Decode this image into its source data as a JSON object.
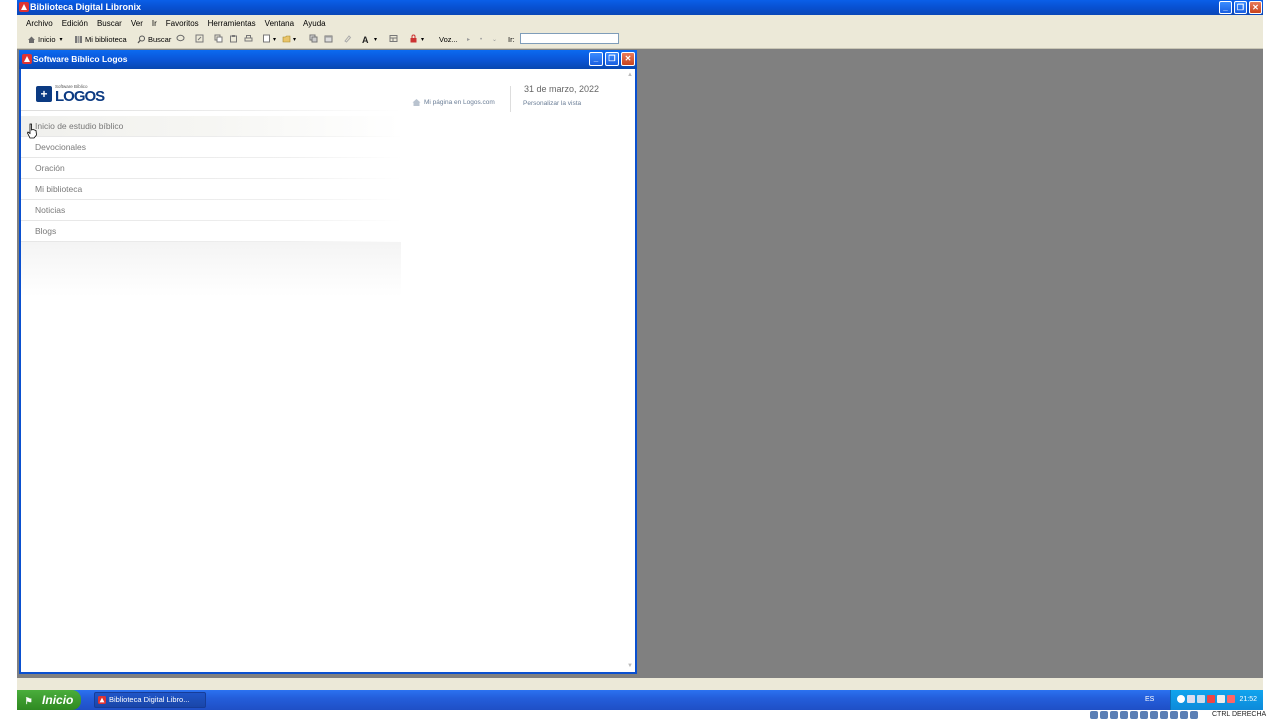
{
  "app": {
    "title": "Biblioteca Digital Libronix",
    "menu": [
      "Archivo",
      "Edición",
      "Buscar",
      "Ver",
      "Ir",
      "Favoritos",
      "Herramientas",
      "Ventana",
      "Ayuda"
    ],
    "toolbar": {
      "home": "Inicio",
      "library": "Mi biblioteca",
      "search": "Buscar",
      "voice": "Voz...",
      "goto_label": "Ir:",
      "goto_value": ""
    }
  },
  "child": {
    "title": "Software Bíblico Logos",
    "logo_small": "Software Bíblico",
    "logo_text": "LOGOS",
    "mypage_link": "Mi página en Logos.com",
    "date": "31 de marzo, 2022",
    "customize_link": "Personalizar la vista",
    "nav": [
      "Inicio de estudio bíblico",
      "Devocionales",
      "Oración",
      "Mi biblioteca",
      "Noticias",
      "Blogs"
    ]
  },
  "taskbar": {
    "start": "Inicio",
    "task": "Biblioteca Digital Libro...",
    "language": "ES",
    "clock": "21:52",
    "host_key": "CTRL DERECHA"
  },
  "colors": {
    "titlebar": "#0a56d8",
    "workspace": "#808080",
    "menubar": "#ece9d8",
    "start_button": "#3c9a2e",
    "logos_blue": "#0b3a82"
  }
}
